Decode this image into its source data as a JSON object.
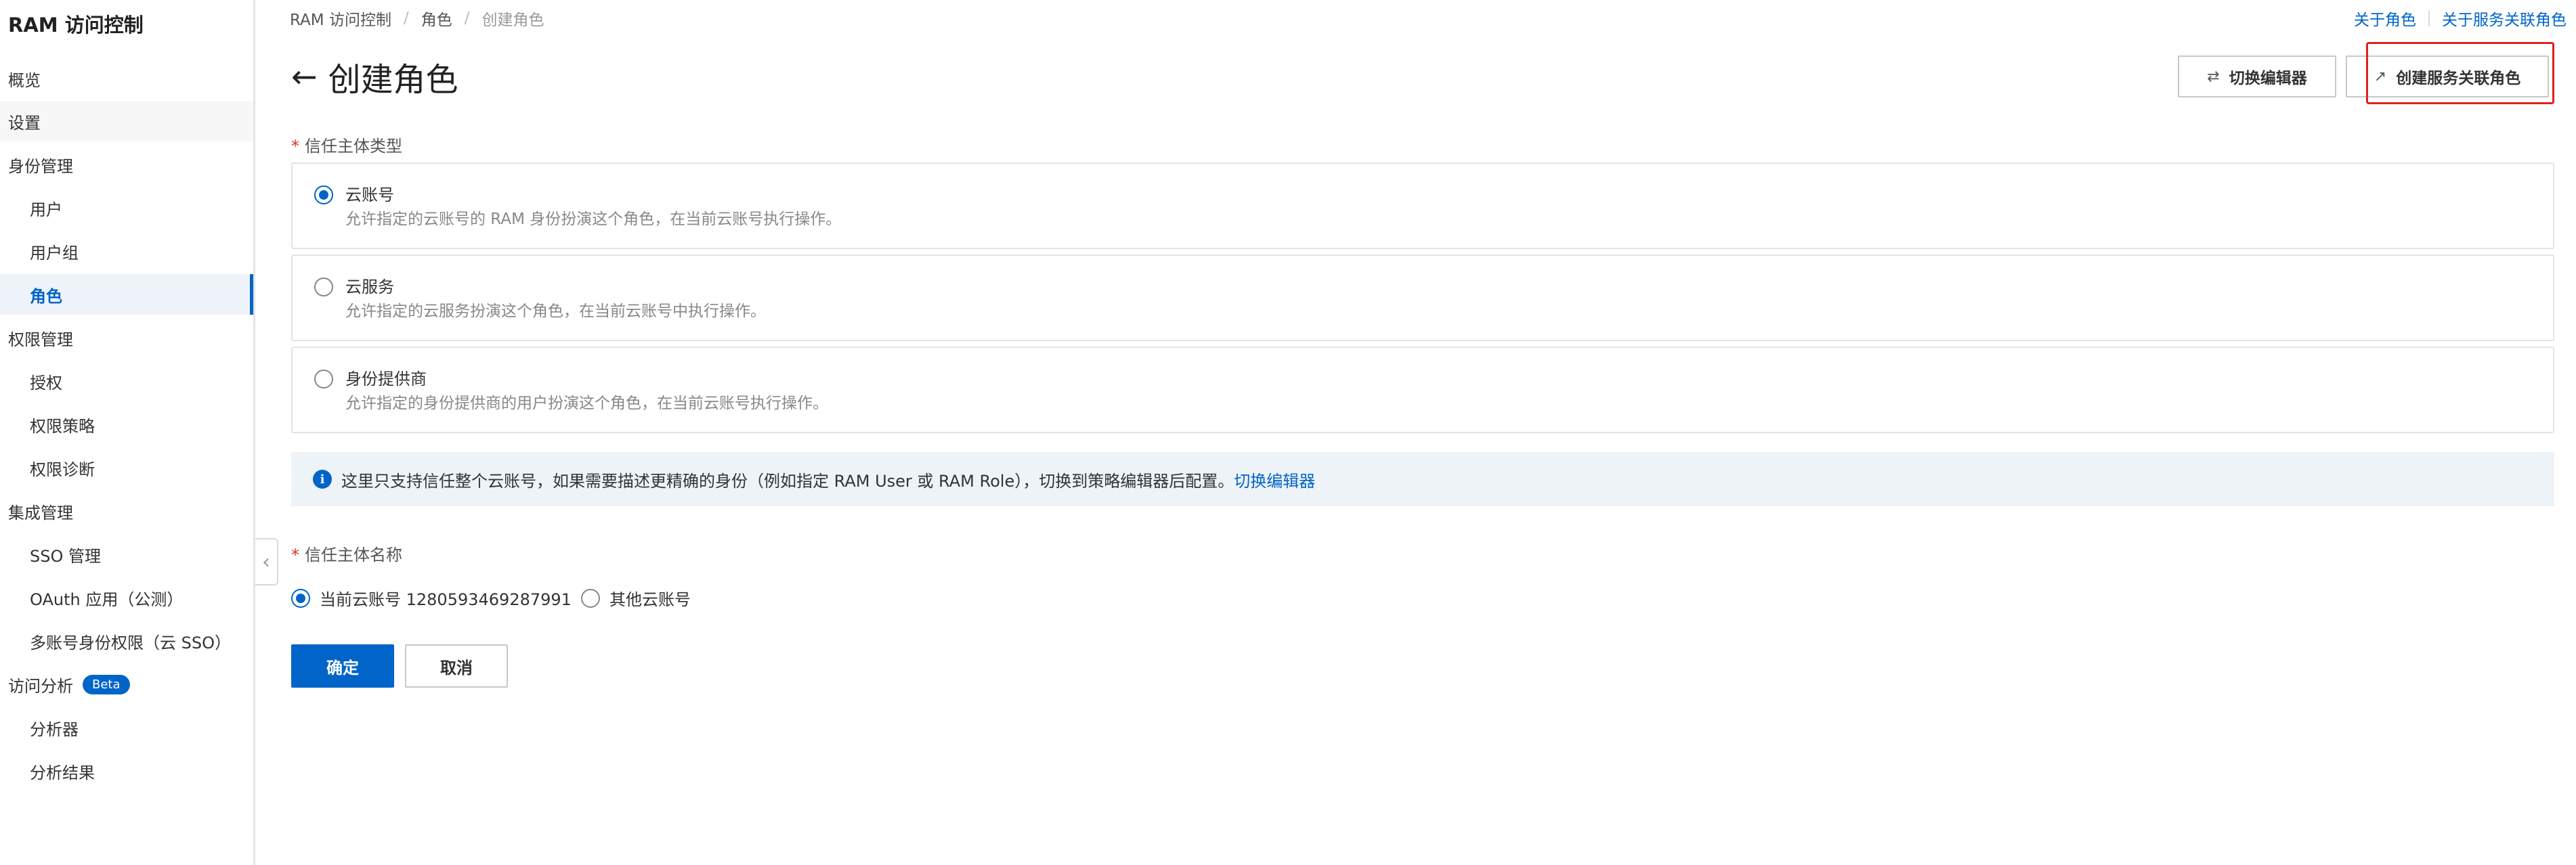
{
  "sidebar": {
    "title": "RAM 访问控制",
    "items": [
      {
        "label": "概览"
      },
      {
        "label": "设置"
      },
      {
        "label": "身份管理"
      },
      {
        "label": "用户"
      },
      {
        "label": "用户组"
      },
      {
        "label": "角色"
      },
      {
        "label": "权限管理"
      },
      {
        "label": "授权"
      },
      {
        "label": "权限策略"
      },
      {
        "label": "权限诊断"
      },
      {
        "label": "集成管理"
      },
      {
        "label": "SSO 管理"
      },
      {
        "label": "OAuth 应用（公测）"
      },
      {
        "label": "多账号身份权限（云 SSO）"
      },
      {
        "label": "访问分析",
        "badge": "Beta"
      },
      {
        "label": "分析器"
      },
      {
        "label": "分析结果"
      }
    ],
    "collapse_icon": "chevron-left-icon"
  },
  "breadcrumb": [
    "RAM 访问控制",
    "角色",
    "创建角色"
  ],
  "top_links": [
    "关于角色",
    "关于服务关联角色"
  ],
  "page_title": "创建角色",
  "header_buttons": {
    "switch_editor": "切换编辑器",
    "create_service_role": "创建服务关联角色"
  },
  "trust_type": {
    "label": "信任主体类型",
    "options": [
      {
        "title": "云账号",
        "desc": "允许指定的云账号的 RAM 身份扮演这个角色，在当前云账号执行操作。",
        "checked": true
      },
      {
        "title": "云服务",
        "desc": "允许指定的云服务扮演这个角色，在当前云账号中执行操作。",
        "checked": false
      },
      {
        "title": "身份提供商",
        "desc": "允许指定的身份提供商的用户扮演这个角色，在当前云账号执行操作。",
        "checked": false
      }
    ]
  },
  "notice": {
    "text": "这里只支持信任整个云账号，如果需要描述更精确的身份（例如指定 RAM User 或 RAM Role），切换到策略编辑器后配置。",
    "link": "切换编辑器"
  },
  "trust_name": {
    "label": "信任主体名称",
    "current": "当前云账号 1280593469287991",
    "other": "其他云账号"
  },
  "actions": {
    "confirm": "确定",
    "cancel": "取消"
  },
  "colors": {
    "accent": "#0064c8",
    "highlight_box": "#e02020"
  }
}
